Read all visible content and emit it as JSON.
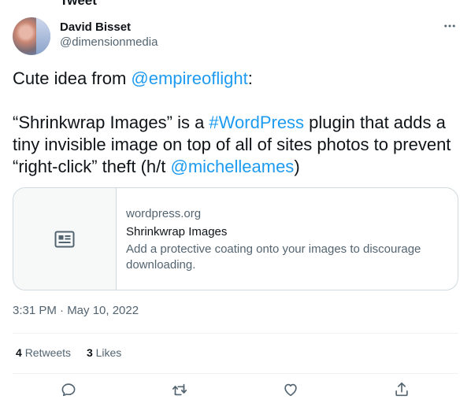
{
  "clipped_header_text": "Tweet",
  "author": {
    "display_name": "David Bisset",
    "handle": "@dimensionmedia"
  },
  "tweet": {
    "p1_prefix": "Cute idea from ",
    "p1_mention": "@empireoflight",
    "p1_suffix": ":",
    "p2_prefix": "“Shrinkwrap Images” is a ",
    "p2_hashtag": "#WordPress",
    "p2_middle": " plugin that adds a tiny invisible image on top of all of sites photos to prevent “right-click” theft (h/t ",
    "p2_mention": "@michelleames",
    "p2_suffix": ")"
  },
  "card": {
    "domain": "wordpress.org",
    "title": "Shrinkwrap Images",
    "description": "Add a protective coating onto your images to discourage downloading.",
    "icon": "article-icon"
  },
  "timestamp": "3:31 PM · May 10, 2022",
  "stats": {
    "retweets_count": "4",
    "retweets_label": "Retweets",
    "likes_count": "3",
    "likes_label": "Likes"
  },
  "actions": [
    "reply-icon",
    "retweet-icon",
    "like-icon",
    "share-icon"
  ],
  "colors": {
    "link": "#1d9bf0",
    "text": "#0f1419",
    "secondary": "#536471",
    "border": "#cfd9de"
  }
}
